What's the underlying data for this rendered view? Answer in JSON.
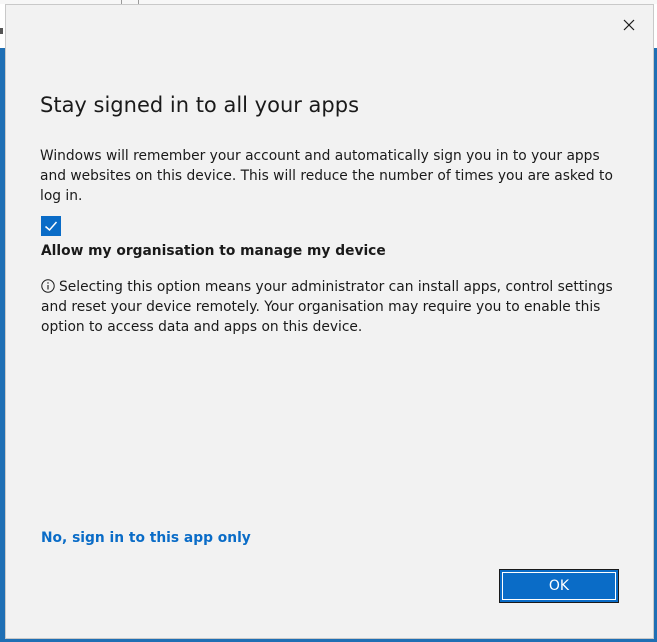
{
  "dialog": {
    "close_icon": "close-icon",
    "title": "Stay signed in to all your apps",
    "description": "Windows will remember your account and automatically sign you in to your apps and websites on this device. This will reduce the number of times you are asked to log in.",
    "checkbox": {
      "checked": true,
      "label": "Allow my organisation to manage my device"
    },
    "info": {
      "icon": "info-icon",
      "text": "Selecting this option means your administrator can install apps, control settings and reset your device remotely. Your organisation may require you to enable this option to access data and apps on this device."
    },
    "secondary_link": "No, sign in to this app only",
    "ok_button": "OK"
  },
  "colors": {
    "accent": "#0a6cc7",
    "dialog_background": "#f2f2f2",
    "text": "#1a1a1a",
    "frame": "#1f6fb4"
  }
}
